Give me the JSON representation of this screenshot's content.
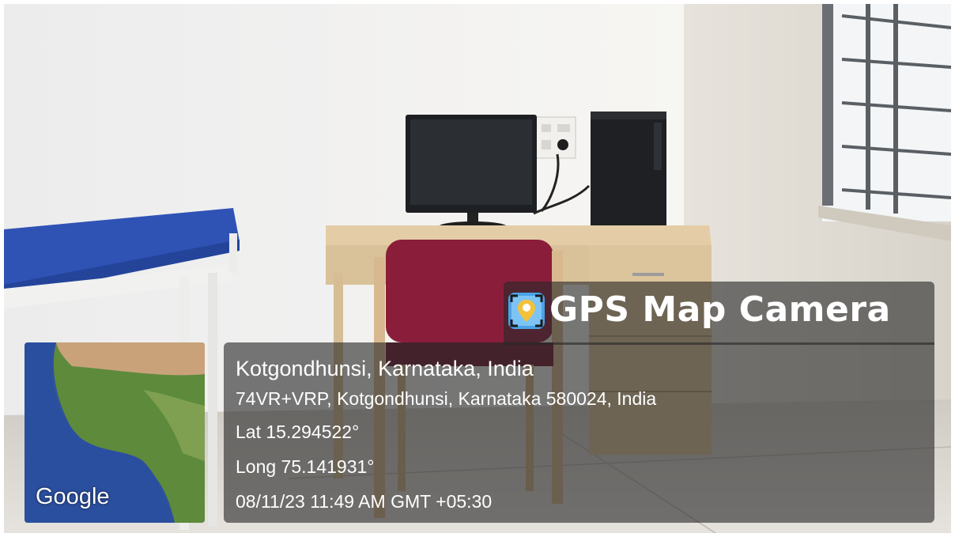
{
  "app": {
    "title": "GPS Map Camera",
    "icon": "map-pin-camera-icon"
  },
  "location": {
    "title": "Kotgondhunsi, Karnataka, India",
    "address": "74VR+VRP, Kotgondhunsi, Karnataka 580024, India",
    "latitude": "Lat 15.294522°",
    "longitude": "Long 75.141931°",
    "datetime": "08/11/23 11:49 AM GMT +05:30"
  },
  "map": {
    "provider": "Google"
  },
  "colors": {
    "overlay": "#282828",
    "text": "#ffffff",
    "sea": "#2a4fa0",
    "land": "#5e8a3c",
    "bench": "#2f52b5",
    "chair": "#8a1e3a",
    "desk": "#e2c8a0"
  }
}
